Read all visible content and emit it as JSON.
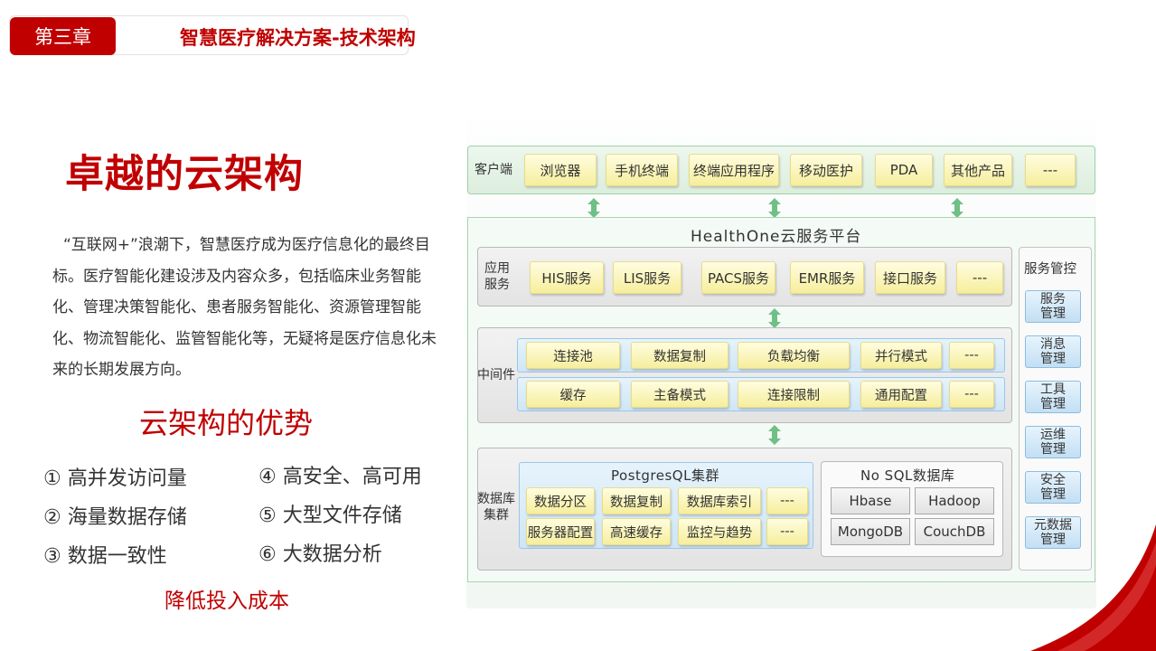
{
  "header": {
    "chapter": "第三章",
    "title": "智慧医疗解决方案-技术架构"
  },
  "main_title": "卓越的云架构",
  "intro": "“互联网+”浪潮下，智慧医疗成为医疗信息化的最终目标。医疗智能化建设涉及内容众多，包括临床业务智能化、管理决策智能化、患者服务智能化、资源管理智能化、物流智能化、监管智能化等，无疑将是医疗信息化未来的长期发展方向。",
  "advantages": {
    "title": "云架构的优势",
    "items": [
      "① 高并发访问量",
      "② 海量数据存储",
      "③ 数据一致性",
      "④ 高安全、高可用",
      "⑤ 大型文件存储",
      "⑥ 大数据分析"
    ],
    "footer": "降低投入成本"
  },
  "diagram": {
    "client": {
      "label": "客户端",
      "items": [
        "浏览器",
        "手机终端",
        "终端应用程序",
        "移动医护",
        "PDA",
        "其他产品",
        "---"
      ]
    },
    "platform_title": "HealthOne云服务平台",
    "app_service": {
      "label": "应用\n服务",
      "items": [
        "HIS服务",
        "LIS服务",
        "PACS服务",
        "EMR服务",
        "接口服务",
        "---"
      ]
    },
    "middleware": {
      "label": "中间件",
      "row1": [
        "连接池",
        "数据复制",
        "负载均衡",
        "并行模式",
        "---"
      ],
      "row2": [
        "缓存",
        "主备模式",
        "连接限制",
        "通用配置",
        "---"
      ]
    },
    "database": {
      "label": "数据库\n集群",
      "pg_title": "PostgresQL集群",
      "pg_row1": [
        "数据分区",
        "数据复制",
        "数据库索引",
        "---"
      ],
      "pg_row2": [
        "服务器配置",
        "高速缓存",
        "监控与趋势",
        "---"
      ],
      "nosql_title": "No SQL数据库",
      "nosql_items": [
        "Hbase",
        "Hadoop",
        "MongoDB",
        "CouchDB"
      ]
    },
    "service_control": {
      "title": "服务管控",
      "items": [
        "服务\n管理",
        "消息\n管理",
        "工具\n管理",
        "运维\n管理",
        "安全\n管理",
        "元数据\n管理"
      ]
    }
  },
  "colors": {
    "brand_red": "#c00000",
    "frame_green": "#9fcfa8",
    "box_yellow": "#f6ee9c",
    "box_blue": "#c2dff4"
  }
}
